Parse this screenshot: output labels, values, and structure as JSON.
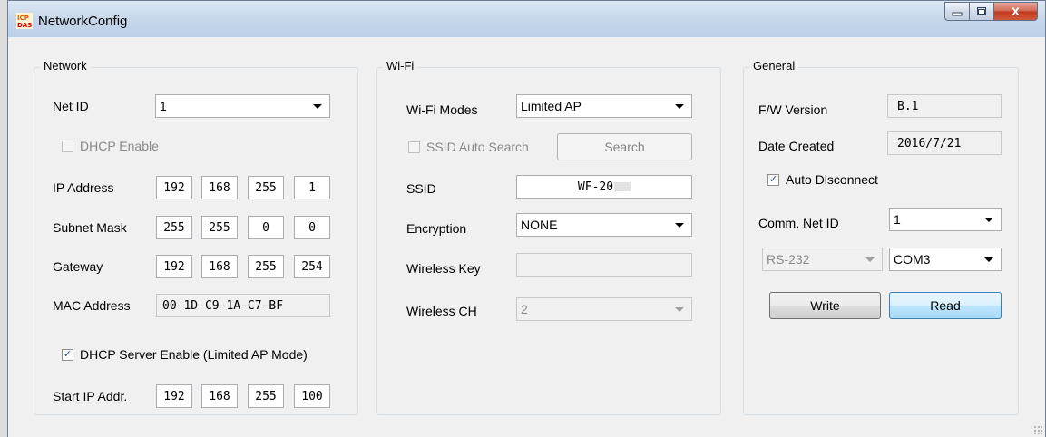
{
  "window": {
    "title": "NetworkConfig",
    "close_glyph": "x",
    "max_glyph": "▭",
    "min_glyph": "_"
  },
  "network": {
    "title": "Network",
    "net_id_label": "Net ID",
    "net_id_value": "1",
    "dhcp_enable_label": "DHCP Enable",
    "dhcp_enable_checked": false,
    "ip_label": "IP Address",
    "ip": [
      "192",
      "168",
      "255",
      "1"
    ],
    "mask_label": "Subnet Mask",
    "mask": [
      "255",
      "255",
      "0",
      "0"
    ],
    "gateway_label": "Gateway",
    "gateway": [
      "192",
      "168",
      "255",
      "254"
    ],
    "mac_label": "MAC Address",
    "mac_value": "00-1D-C9-1A-C7-BF",
    "dhcp_server_label": "DHCP Server Enable (Limited AP Mode)",
    "dhcp_server_checked": true,
    "start_ip_label": "Start IP Addr.",
    "start_ip": [
      "192",
      "168",
      "255",
      "100"
    ]
  },
  "wifi": {
    "title": "Wi-Fi",
    "modes_label": "Wi-Fi Modes",
    "modes_value": "Limited AP",
    "ssid_auto_label": "SSID Auto Search",
    "search_button": "Search",
    "ssid_label": "SSID",
    "ssid_value": "WF-20",
    "encryption_label": "Encryption",
    "encryption_value": "NONE",
    "wireless_key_label": "Wireless Key",
    "wireless_key_value": "",
    "wireless_ch_label": "Wireless CH",
    "wireless_ch_value": "2"
  },
  "general": {
    "title": "General",
    "fw_label": "F/W Version",
    "fw_value": "B.1",
    "date_label": "Date Created",
    "date_value": "2016/7/21",
    "auto_disconnect_label": "Auto Disconnect",
    "auto_disconnect_checked": true,
    "comm_net_id_label": "Comm. Net ID",
    "comm_net_id_value": "1",
    "interface_value": "RS-232",
    "port_value": "COM3",
    "write_button": "Write",
    "read_button": "Read"
  },
  "colors": {
    "title_bar": "#c5d6ea",
    "close_button": "#c2391e",
    "focus_border": "#3c7fb1"
  }
}
